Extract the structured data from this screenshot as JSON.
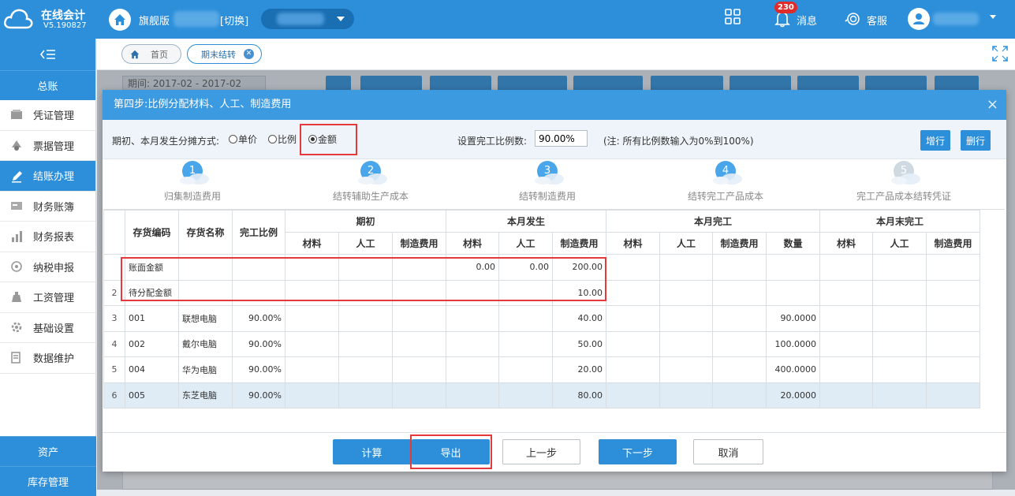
{
  "app": {
    "name": "在线会计",
    "version": "V5.190827",
    "edition": "旗舰版",
    "switch_label": "[切换]",
    "message_badge": "230",
    "message_label": "消息",
    "service_label": "客服"
  },
  "sidebar": {
    "section_top": "总账",
    "items": [
      {
        "label": "凭证管理",
        "icon": "voucher-icon"
      },
      {
        "label": "票据管理",
        "icon": "receipt-icon"
      },
      {
        "label": "结账办理",
        "icon": "pen-icon",
        "active": true
      },
      {
        "label": "财务账簿",
        "icon": "ledger-icon"
      },
      {
        "label": "财务报表",
        "icon": "bar-chart-icon"
      },
      {
        "label": "纳税申报",
        "icon": "tax-icon"
      },
      {
        "label": "工资管理",
        "icon": "salary-icon"
      },
      {
        "label": "基础设置",
        "icon": "settings-icon"
      },
      {
        "label": "数据维护",
        "icon": "data-icon"
      }
    ],
    "section_assets": "资产",
    "section_inventory": "库存管理"
  },
  "tabs": {
    "home": "首页",
    "active": "期末结转"
  },
  "background": {
    "period_label": "期间:",
    "period_value": "2017-02 - 2017-02"
  },
  "modal": {
    "title": "第四步:比例分配材料、人工、制造费用",
    "alloc_label": "期初、本月发生分摊方式:",
    "radio_unit": "单价",
    "radio_ratio": "比例",
    "radio_amount": "金额",
    "ratio_label": "设置完工比例数:",
    "ratio_value": "90.00%",
    "ratio_note": "(注: 所有比例数输入为0%到100%)",
    "btn_add_row": "增行",
    "btn_del_row": "删行",
    "steps": [
      {
        "num": "1",
        "label": "归集制造费用"
      },
      {
        "num": "2",
        "label": "结转辅助生产成本"
      },
      {
        "num": "3",
        "label": "结转制造费用"
      },
      {
        "num": "4",
        "label": "结转完工产品成本"
      },
      {
        "num": "5",
        "label": "完工产品成本结转凭证"
      }
    ],
    "table": {
      "col_code": "存货编码",
      "col_name": "存货名称",
      "col_ratio": "完工比例",
      "grp_begin": "期初",
      "grp_month": "本月发生",
      "grp_done": "本月完工",
      "grp_undone": "本月末完工",
      "sub_material": "材料",
      "sub_labor": "人工",
      "sub_overhead": "制造费用",
      "sub_qty": "数量",
      "rows": [
        {
          "rn": "",
          "code": "账面金额",
          "name": "",
          "ratio": "",
          "m_mat": "0.00",
          "m_lab": "0.00",
          "m_ovh": "200.00",
          "qty": ""
        },
        {
          "rn": "2",
          "code": "待分配金额",
          "name": "",
          "ratio": "",
          "m_mat": "",
          "m_lab": "",
          "m_ovh": "10.00",
          "qty": ""
        },
        {
          "rn": "3",
          "code": "001",
          "name": "联想电脑",
          "ratio": "90.00%",
          "m_mat": "",
          "m_lab": "",
          "m_ovh": "40.00",
          "qty": "90.0000"
        },
        {
          "rn": "4",
          "code": "002",
          "name": "戴尔电脑",
          "ratio": "90.00%",
          "m_mat": "",
          "m_lab": "",
          "m_ovh": "50.00",
          "qty": "100.0000"
        },
        {
          "rn": "5",
          "code": "004",
          "name": "华为电脑",
          "ratio": "90.00%",
          "m_mat": "",
          "m_lab": "",
          "m_ovh": "20.00",
          "qty": "400.0000"
        },
        {
          "rn": "6",
          "code": "005",
          "name": "东芝电脑",
          "ratio": "90.00%",
          "m_mat": "",
          "m_lab": "",
          "m_ovh": "80.00",
          "qty": "20.0000"
        }
      ]
    },
    "footer": {
      "calc": "计算",
      "export": "导出",
      "prev": "上一步",
      "next": "下一步",
      "cancel": "取消"
    }
  },
  "colors": {
    "brand": "#2d8fd9",
    "highlight": "#e5393b"
  }
}
